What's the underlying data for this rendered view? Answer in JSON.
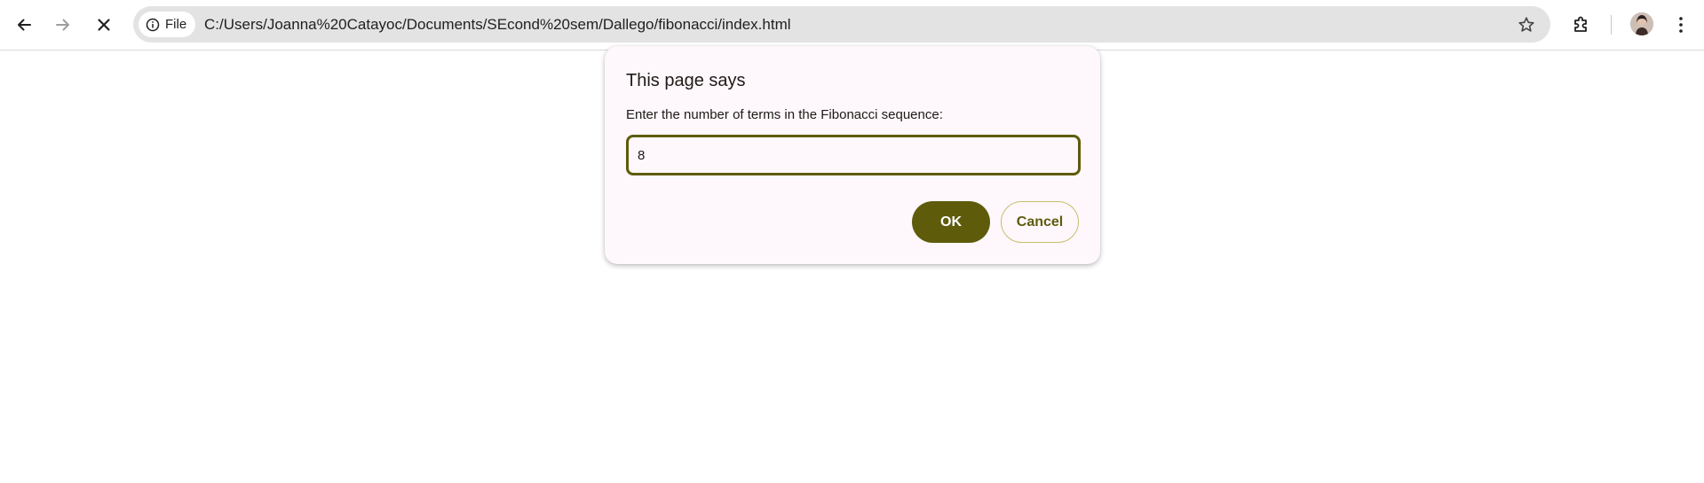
{
  "browser": {
    "site_chip_label": "File",
    "url": "C:/Users/Joanna%20Catayoc/Documents/SEcond%20sem/Dallego/fibonacci/index.html",
    "icons": {
      "back": "arrow-left-icon",
      "forward": "arrow-right-icon",
      "stop": "close-icon",
      "site_info": "info-icon",
      "bookmark": "star-icon",
      "extensions": "puzzle-icon",
      "profile": "avatar",
      "menu": "kebab-menu-icon"
    }
  },
  "dialog": {
    "title": "This page says",
    "message": "Enter the number of terms in the Fibonacci sequence:",
    "input_value": "8",
    "ok_label": "OK",
    "cancel_label": "Cancel"
  },
  "colors": {
    "accent": "#5e5c0b",
    "dialog_bg": "#fef7fb",
    "omnibox_bg": "#e3e3e3",
    "forward_disabled": "#9e9e9e"
  }
}
